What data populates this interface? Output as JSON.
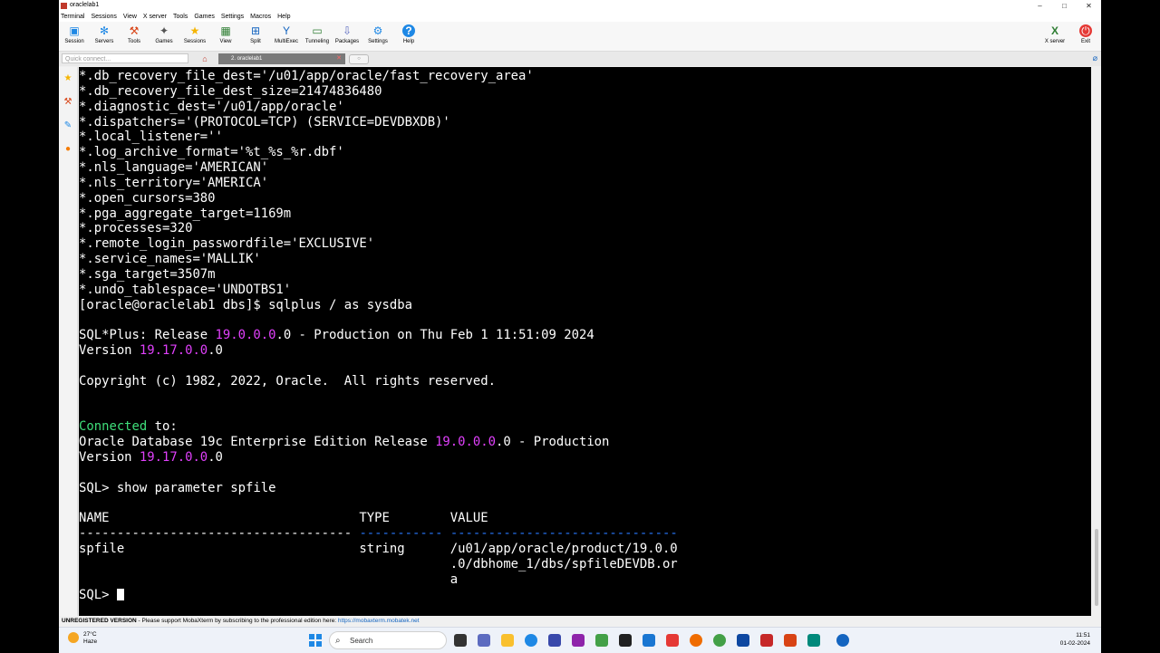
{
  "window": {
    "title": "oraclelab1",
    "buttons": [
      "–",
      "□",
      "✕"
    ]
  },
  "menu": [
    "Terminal",
    "Sessions",
    "View",
    "X server",
    "Tools",
    "Games",
    "Settings",
    "Macros",
    "Help"
  ],
  "toolbar": [
    {
      "label": "Session",
      "icon": "session-icon"
    },
    {
      "label": "Servers",
      "icon": "servers-icon"
    },
    {
      "label": "Tools",
      "icon": "tools-icon"
    },
    {
      "label": "Games",
      "icon": "games-icon"
    },
    {
      "label": "Sessions",
      "icon": "sessions-star-icon"
    },
    {
      "label": "View",
      "icon": "view-icon"
    },
    {
      "label": "Split",
      "icon": "split-icon"
    },
    {
      "label": "MultiExec",
      "icon": "multiexec-icon"
    },
    {
      "label": "Tunneling",
      "icon": "tunneling-icon"
    },
    {
      "label": "Packages",
      "icon": "packages-icon"
    },
    {
      "label": "Settings",
      "icon": "settings-icon"
    },
    {
      "label": "Help",
      "icon": "help-icon"
    }
  ],
  "toolbar_right": [
    {
      "label": "X server",
      "icon": "x-server-icon"
    },
    {
      "label": "Exit",
      "icon": "power-icon"
    }
  ],
  "quick_connect": {
    "placeholder": "Quick connect..."
  },
  "tab": {
    "label": "2. oraclelab1",
    "close": "✕"
  },
  "terminal": {
    "lines": [
      [
        {
          "t": "*.db_recovery_file_dest='/u01/app/oracle/fast_recovery_area'"
        }
      ],
      [
        {
          "t": "*.db_recovery_file_dest_size=21474836480"
        }
      ],
      [
        {
          "t": "*.diagnostic_dest='/u01/app/oracle'"
        }
      ],
      [
        {
          "t": "*.dispatchers='(PROTOCOL=TCP) (SERVICE=DEVDBXDB)'"
        }
      ],
      [
        {
          "t": "*.local_listener=''"
        }
      ],
      [
        {
          "t": "*.log_archive_format='%t_%s_%r.dbf'"
        }
      ],
      [
        {
          "t": "*.nls_language='AMERICAN'"
        }
      ],
      [
        {
          "t": "*.nls_territory='AMERICA'"
        }
      ],
      [
        {
          "t": "*.open_cursors=380"
        }
      ],
      [
        {
          "t": "*.pga_aggregate_target=1169m"
        }
      ],
      [
        {
          "t": "*.processes=320"
        }
      ],
      [
        {
          "t": "*.remote_login_passwordfile='EXCLUSIVE'"
        }
      ],
      [
        {
          "t": "*.service_names='MALLIK'"
        }
      ],
      [
        {
          "t": "*.sga_target=3507m"
        }
      ],
      [
        {
          "t": "*.undo_tablespace='UNDOTBS1'"
        }
      ],
      [
        {
          "t": "[oracle@oraclelab1 dbs]$ sqlplus / as sysdba"
        }
      ],
      [
        {
          "t": ""
        }
      ],
      [
        {
          "t": "SQL*Plus: Release "
        },
        {
          "t": "19.0.0.0",
          "c": "mag"
        },
        {
          "t": ".0 - Production on Thu Feb 1 11:51:09 2024"
        }
      ],
      [
        {
          "t": "Version "
        },
        {
          "t": "19.17.0.0",
          "c": "mag"
        },
        {
          "t": ".0"
        }
      ],
      [
        {
          "t": ""
        }
      ],
      [
        {
          "t": "Copyright (c) 1982, 2022, Oracle.  All rights reserved."
        }
      ],
      [
        {
          "t": ""
        }
      ],
      [
        {
          "t": ""
        }
      ],
      [
        {
          "t": "Connected",
          "c": "grn"
        },
        {
          "t": " to:"
        }
      ],
      [
        {
          "t": "Oracle Database 19c Enterprise Edition Release "
        },
        {
          "t": "19.0.0.0",
          "c": "mag"
        },
        {
          "t": ".0 - Production"
        }
      ],
      [
        {
          "t": "Version "
        },
        {
          "t": "19.17.0.0",
          "c": "mag"
        },
        {
          "t": ".0"
        }
      ],
      [
        {
          "t": ""
        }
      ],
      [
        {
          "t": "SQL> show parameter spfile"
        }
      ],
      [
        {
          "t": ""
        }
      ],
      [
        {
          "t": "NAME                                 TYPE        VALUE"
        }
      ],
      [
        {
          "t": "------------------------------------ ",
          "c": "dash"
        },
        {
          "t": "-----------",
          "c": "blu"
        },
        {
          "t": " "
        },
        {
          "t": "------------------------------",
          "c": "blu"
        }
      ],
      [
        {
          "t": "spfile                               string      /u01/app/oracle/product/19.0.0"
        }
      ],
      [
        {
          "t": "                                                 .0/dbhome_1/dbs/spfileDEVDB.or"
        }
      ],
      [
        {
          "t": "                                                 a"
        }
      ],
      [
        {
          "t": "SQL> "
        },
        {
          "t": "",
          "c": "cursor"
        }
      ]
    ]
  },
  "statusbar": {
    "unregistered": "UNREGISTERED VERSION",
    "message": "  -  Please support MobaXterm by subscribing to the professional edition here:  ",
    "link": "https://mobaxterm.mobatek.net"
  },
  "taskbar": {
    "weather_temp": "27°C",
    "weather_desc": "Haze",
    "search_label": "Search",
    "time": "11:51",
    "date": "01-02-2024"
  }
}
